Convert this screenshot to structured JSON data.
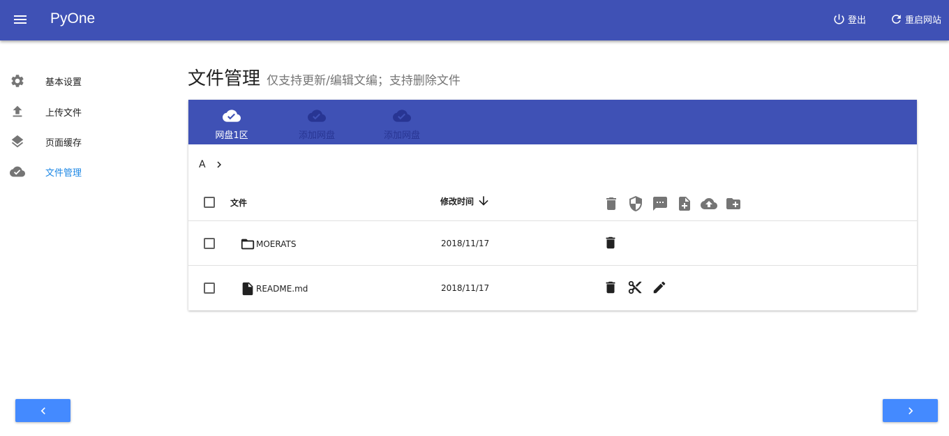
{
  "app": {
    "brand": "PyOne"
  },
  "topbar": {
    "login_label": "登出",
    "restart_label": "重启网站"
  },
  "sidebar": {
    "items": [
      {
        "label": "基本设置",
        "icon": "gear-icon"
      },
      {
        "label": "上传文件",
        "icon": "upload-icon"
      },
      {
        "label": "页面缓存",
        "icon": "layers-icon"
      },
      {
        "label": "文件管理",
        "icon": "cloud-done-icon",
        "active": true
      }
    ]
  },
  "page": {
    "title": "文件管理",
    "subtitle": "仅支持更新/编辑文编；支持删除文件"
  },
  "tabs": [
    {
      "label": "网盘1区",
      "active": true
    },
    {
      "label": "添加网盘"
    },
    {
      "label": "添加网盘"
    }
  ],
  "breadcrumb": {
    "root": "A"
  },
  "table": {
    "headers": {
      "name": "文件",
      "time": "修改时间"
    },
    "header_actions": [
      "delete-icon",
      "shield-icon",
      "comment-icon",
      "new-file-icon",
      "cloud-upload-icon",
      "new-folder-icon"
    ],
    "rows": [
      {
        "name": "MOERATS",
        "type": "folder",
        "date": "2018/11/17",
        "actions": [
          "delete-icon"
        ]
      },
      {
        "name": "README.md",
        "type": "file",
        "date": "2018/11/17",
        "actions": [
          "delete-icon",
          "cut-icon",
          "edit-icon"
        ]
      }
    ]
  },
  "colors": {
    "primary": "#3f51b5",
    "accent": "#448aff",
    "active_text": "#1e88e5"
  }
}
